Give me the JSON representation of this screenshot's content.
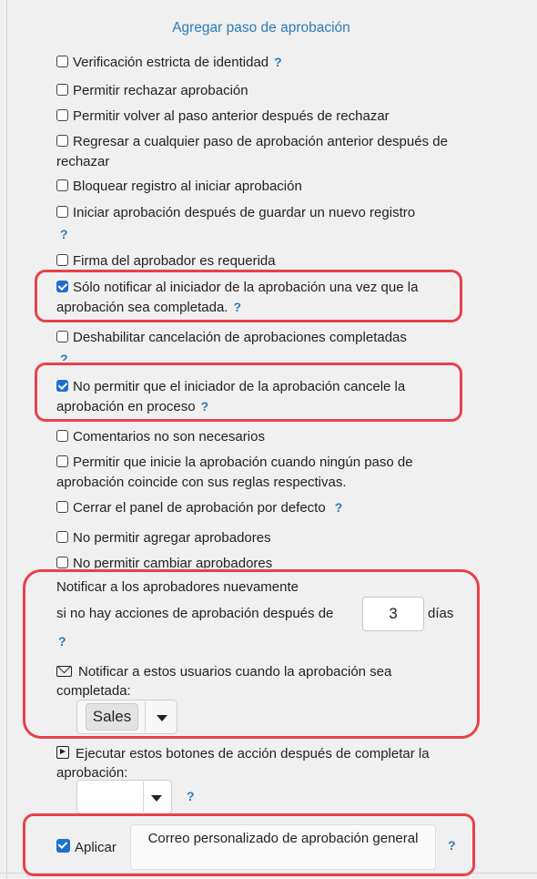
{
  "panel": {
    "title": "Agregar paso de aprobación"
  },
  "help_mark": "?",
  "options": [
    {
      "label": "Verificación estricta de identidad",
      "checked": false,
      "help": true
    },
    {
      "label": "Permitir rechazar aprobación",
      "checked": false,
      "help": false
    },
    {
      "label": "Permitir volver al paso anterior después de rechazar",
      "checked": false,
      "help": false
    },
    {
      "label": "Regresar a cualquier paso de aprobación anterior después de rechazar",
      "checked": false,
      "help": false
    },
    {
      "label": "Bloquear registro al iniciar aprobación",
      "checked": false,
      "help": false
    },
    {
      "label": "Iniciar aprobación después de guardar un nuevo registro",
      "checked": false,
      "help": true
    },
    {
      "label": "Firma del aprobador es requerida",
      "checked": false,
      "help": false
    },
    {
      "label": "Sólo notificar al iniciador de la aprobación una vez que la aprobación sea completada.",
      "checked": true,
      "help": true
    },
    {
      "label": "Deshabilitar cancelación de aprobaciones completadas",
      "checked": false,
      "help": true
    },
    {
      "label": "No permitir que el iniciador de la aprobación cancele la aprobación en proceso",
      "checked": true,
      "help": true
    },
    {
      "label": "Comentarios no son necesarios",
      "checked": false,
      "help": false
    },
    {
      "label": "Permitir que inicie la aprobación cuando ningún paso de aprobación coincide con sus reglas respectivas.",
      "checked": false,
      "help": false
    },
    {
      "label": "Cerrar el panel de aprobación por defecto",
      "checked": false,
      "help": true
    },
    {
      "label": "No permitir agregar aprobadores",
      "checked": false,
      "help": false
    },
    {
      "label": "No permitir cambiar aprobadores",
      "checked": false,
      "help": false
    }
  ],
  "renotify": {
    "heading": "Notificar a los aprobadores nuevamente",
    "prefix": "si no hay acciones de aprobación después de",
    "days_value": "3",
    "suffix": "días"
  },
  "notify_users": {
    "label": "Notificar a estos usuarios cuando la aprobación sea completada:",
    "selected": "Sales"
  },
  "action_buttons": {
    "label": "Ejecutar estos botones de acción después de completar la aprobación:",
    "selected": ""
  },
  "apply": {
    "checkbox_label": "Aplicar",
    "checked": true,
    "button_label": "Correo personalizado de aprobación general"
  },
  "colors": {
    "accent": "#2b7bb9",
    "checkbox": "#1f6fd0",
    "highlight": "#e8414b"
  }
}
